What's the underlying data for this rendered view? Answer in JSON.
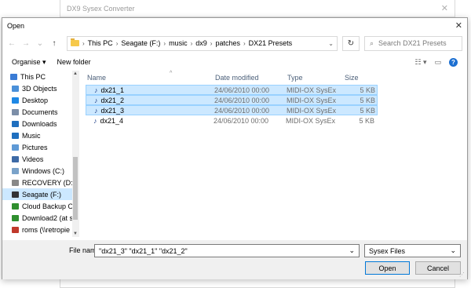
{
  "background_window": {
    "title": "DX9 Sysex Converter",
    "close_icon": "close-icon"
  },
  "dialog": {
    "title": "Open",
    "close_icon": "close-icon"
  },
  "navigation": {
    "back_icon": "←",
    "forward_icon": "→",
    "recent_icon": "⌄",
    "up_icon": "↑",
    "breadcrumbs": [
      "This PC",
      "Seagate (F:)",
      "music",
      "dx9",
      "patches",
      "DX21 Presets"
    ],
    "search_placeholder": "Search DX21 Presets"
  },
  "toolbar": {
    "organise_label": "Organise ▾",
    "new_folder_label": "New folder"
  },
  "sidebar": {
    "items": [
      {
        "label": "This PC",
        "icon": "computer-icon",
        "color": "#3a7bd5"
      },
      {
        "label": "3D Objects",
        "icon": "cube-icon",
        "color": "#4a90d9"
      },
      {
        "label": "Desktop",
        "icon": "desktop-icon",
        "color": "#1e88e5"
      },
      {
        "label": "Documents",
        "icon": "document-icon",
        "color": "#7c8ea8"
      },
      {
        "label": "Downloads",
        "icon": "download-icon",
        "color": "#1f6fbf"
      },
      {
        "label": "Music",
        "icon": "music-icon",
        "color": "#1f6fbf"
      },
      {
        "label": "Pictures",
        "icon": "picture-icon",
        "color": "#5f9ad6"
      },
      {
        "label": "Videos",
        "icon": "video-icon",
        "color": "#3d6aa6"
      },
      {
        "label": "Windows (C:)",
        "icon": "drive-icon",
        "color": "#7aa2c9"
      },
      {
        "label": "RECOVERY (D:)",
        "icon": "drive-icon",
        "color": "#888888"
      },
      {
        "label": "Seagate (F:)",
        "icon": "drive-icon",
        "color": "#333333"
      },
      {
        "label": "Cloud Backup O",
        "icon": "network-drive-icon",
        "color": "#2f8f2f"
      },
      {
        "label": "Download2 (at s",
        "icon": "network-drive-icon",
        "color": "#2f8f2f"
      },
      {
        "label": "roms (\\\\retropie",
        "icon": "network-drive-icon",
        "color": "#c0392b"
      }
    ]
  },
  "file_list": {
    "columns": [
      "Name",
      "Date modified",
      "Type",
      "Size"
    ],
    "rows": [
      {
        "name": "dx21_1",
        "date": "24/06/2010 00:00",
        "type": "MIDI-OX SysEx",
        "size": "5 KB",
        "selected": true
      },
      {
        "name": "dx21_2",
        "date": "24/06/2010 00:00",
        "type": "MIDI-OX SysEx",
        "size": "5 KB",
        "selected": true
      },
      {
        "name": "dx21_3",
        "date": "24/06/2010 00:00",
        "type": "MIDI-OX SysEx",
        "size": "5 KB",
        "selected": true
      },
      {
        "name": "dx21_4",
        "date": "24/06/2010 00:00",
        "type": "MIDI-OX SysEx",
        "size": "5 KB",
        "selected": false
      }
    ]
  },
  "bottom": {
    "filename_label": "File name:",
    "filename_value": "\"dx21_3\" \"dx21_1\" \"dx21_2\"",
    "filetype_value": "Sysex Files",
    "open_label": "Open",
    "cancel_label": "Cancel"
  },
  "colors": {
    "selection": "#cce8ff",
    "selection_border": "#99d1ff",
    "accent": "#0078d7"
  }
}
